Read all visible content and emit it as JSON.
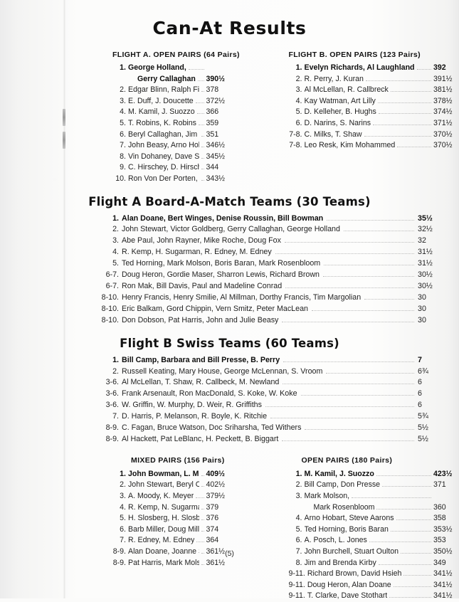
{
  "document": {
    "title": "Can-At Results",
    "page_number": "(5)"
  },
  "flight_a_open_pairs": {
    "heading": "FLIGHT A. OPEN PAIRS (64 Pairs)",
    "rows": [
      {
        "rank": "1.",
        "name": "George Holland,",
        "name2": "Gerry Callaghan",
        "score": "390½",
        "two_line": true
      },
      {
        "rank": "2.",
        "name": "Edgar Blinn, Ralph Fisher",
        "score": "378"
      },
      {
        "rank": "3.",
        "name": "E. Duff, J. Doucette",
        "score": "372½"
      },
      {
        "rank": "4.",
        "name": "M. Kamil, J. Suozzo",
        "score": "366"
      },
      {
        "rank": "5.",
        "name": "T. Robins, K. Robins",
        "score": "359"
      },
      {
        "rank": "6.",
        "name": "Beryl Callaghan, Jim Kirby",
        "score": "351"
      },
      {
        "rank": "7.",
        "name": "John Beasy, Arno Hobart",
        "score": "346½"
      },
      {
        "rank": "8.",
        "name": "Vin Dohaney, Dave Stothart",
        "score": "345½"
      },
      {
        "rank": "9.",
        "name": "C. Hirschey, D. Hirschey",
        "score": "344"
      },
      {
        "rank": "10.",
        "name": "Ron Von Der Porten, A. Light",
        "score": "343½"
      }
    ]
  },
  "flight_b_open_pairs": {
    "heading": "FLIGHT B. OPEN PAIRS (123 Pairs)",
    "rows": [
      {
        "rank": "1.",
        "name": "Evelyn Richards, Al Laughland",
        "score": "392"
      },
      {
        "rank": "2.",
        "name": "R. Perry, J. Kuran",
        "score": "391½"
      },
      {
        "rank": "3.",
        "name": "Al McLellan, R. Callbreck",
        "score": "381½"
      },
      {
        "rank": "4.",
        "name": "Kay Watman, Art Lilly",
        "score": "378½"
      },
      {
        "rank": "5.",
        "name": "D. Kelleher, B. Hughs",
        "score": "374½"
      },
      {
        "rank": "6.",
        "name": "D. Narins, S. Narins",
        "score": "371½"
      },
      {
        "rank": "7-8.",
        "name": "C. Milks, T. Shaw",
        "score": "370½"
      },
      {
        "rank": "7-8.",
        "name": "Leo Resk, Kim Mohammed",
        "score": "370½"
      }
    ]
  },
  "flight_a_bam_teams": {
    "title": "Flight A Board-A-Match Teams (30 Teams)",
    "rows": [
      {
        "rank": "1.",
        "name": "Alan Doane, Bert Winges, Denise Roussin, Bill Bowman",
        "score": "35½"
      },
      {
        "rank": "2.",
        "name": "John Stewart, Victor Goldberg, Gerry Callaghan, George Holland",
        "score": "32½"
      },
      {
        "rank": "3.",
        "name": "Abe Paul, John Rayner, Mike Roche, Doug Fox",
        "score": "32"
      },
      {
        "rank": "4.",
        "name": "R. Kemp, H. Sugarman, R. Edney, M. Edney",
        "score": "31½"
      },
      {
        "rank": "5.",
        "name": "Ted Horning, Mark Molson, Boris Baran, Mark Rosenbloom",
        "score": "31½"
      },
      {
        "rank": "6-7.",
        "name": "Doug Heron, Gordie Maser, Sharron Lewis, Richard Brown",
        "score": "30½"
      },
      {
        "rank": "6-7.",
        "name": "Ron Mak, Bill Davis, Paul and Madeline Conrad",
        "score": "30½"
      },
      {
        "rank": "8-10.",
        "name": "Henry Francis, Henry Smilie, Al Millman, Dorthy Francis, Tim Margolian",
        "score": "30"
      },
      {
        "rank": "8-10.",
        "name": "Eric Balkam, Gord Chippin, Vern Smitz, Peter MacLean",
        "score": "30"
      },
      {
        "rank": "8-10.",
        "name": "Don Dobson, Pat Harris, John and Julie Beasy",
        "score": "30"
      }
    ]
  },
  "flight_b_swiss_teams": {
    "title": "Flight B Swiss Teams (60 Teams)",
    "rows": [
      {
        "rank": "1.",
        "name": "Bill Camp, Barbara and Bill Presse, B. Perry",
        "score": "7"
      },
      {
        "rank": "2.",
        "name": "Russell Keating, Mary House, George McLennan, S. Vroom",
        "score": "6¾"
      },
      {
        "rank": "3-6.",
        "name": "Al McLellan, T. Shaw, R. Callbeck, M. Newland",
        "score": "6"
      },
      {
        "rank": "3-6.",
        "name": "Frank Arsenault, Ron MacDonald, S. Koke, W. Koke",
        "score": "6"
      },
      {
        "rank": "3-6.",
        "name": "W. Griffin, W. Murphy, D. Weir, R. Griffiths",
        "score": "6"
      },
      {
        "rank": "7.",
        "name": "D. Harris, P. Melanson, R. Boyle, K. Ritchie",
        "score": "5¾"
      },
      {
        "rank": "8-9.",
        "name": "C. Fagan, Bruce Watson, Doc Sriharsha, Ted Withers",
        "score": "5½"
      },
      {
        "rank": "8-9.",
        "name": "Al Hackett, Pat LeBlanc, H. Peckett, B. Biggart",
        "score": "5½"
      }
    ]
  },
  "mixed_pairs": {
    "heading": "MIXED PAIRS (156 Pairs)",
    "rows": [
      {
        "rank": "1.",
        "name": "John Bowman, L. McIntyre",
        "score": "409½"
      },
      {
        "rank": "2.",
        "name": "John Stewart, Beryl Callaghan",
        "score": "402½"
      },
      {
        "rank": "3.",
        "name": "A. Moody, K. Meyer",
        "score": "379½"
      },
      {
        "rank": "4.",
        "name": "R. Kemp, N. Sugarman",
        "score": "379"
      },
      {
        "rank": "5.",
        "name": "H. Slosberg, H. Slosberg",
        "score": "376"
      },
      {
        "rank": "6.",
        "name": "Barb Miller, Doug Miller",
        "score": "374"
      },
      {
        "rank": "7.",
        "name": "R. Edney, M. Edney",
        "score": "364"
      },
      {
        "rank": "8-9.",
        "name": "Alan Doane, Joanne Snair",
        "score": "361½"
      },
      {
        "rank": "8-9.",
        "name": "Pat Harris, Mark Molson",
        "score": "361½"
      }
    ]
  },
  "open_pairs": {
    "heading": "OPEN PAIRS (180 Pairs)",
    "rows": [
      {
        "rank": "1.",
        "name": "M. Kamil, J. Suozzo",
        "score": "423½"
      },
      {
        "rank": "2.",
        "name": "Bill Camp, Don Presse",
        "score": "371"
      },
      {
        "rank": "3.",
        "name": "Mark Molson,",
        "name2": "Mark Rosenbloom",
        "score": "360",
        "two_line": true
      },
      {
        "rank": "4.",
        "name": "Arno Hobart, Steve Aarons",
        "score": "358"
      },
      {
        "rank": "5.",
        "name": "Ted Horning, Boris Baran",
        "score": "353½"
      },
      {
        "rank": "6.",
        "name": "A. Posch, L. Jones",
        "score": "353"
      },
      {
        "rank": "7.",
        "name": "John Burchell, Stuart Oulton",
        "score": "350½"
      },
      {
        "rank": "8.",
        "name": "Jim and Brenda Kirby",
        "score": "349"
      },
      {
        "rank": "9-11.",
        "name": "Richard Brown, David Hsieh",
        "score": "341½"
      },
      {
        "rank": "9-11.",
        "name": "Doug Heron, Alan Doane",
        "score": "341½"
      },
      {
        "rank": "9-11.",
        "name": "T. Clarke, Dave Stothart",
        "score": "341½"
      }
    ]
  }
}
